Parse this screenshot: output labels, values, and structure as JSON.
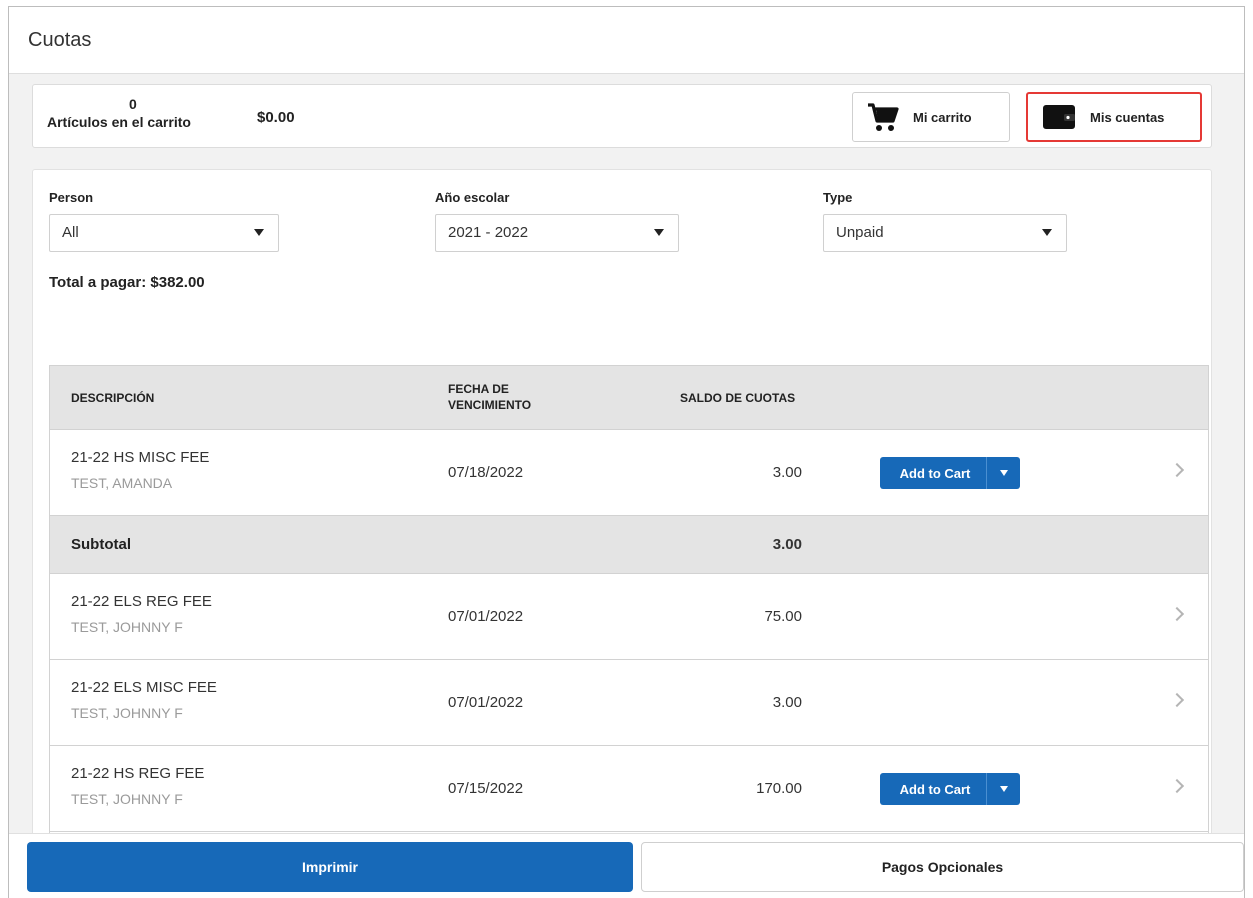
{
  "page": {
    "title": "Cuotas"
  },
  "cart": {
    "count": "0",
    "count_label": "Artículos en el carrito",
    "total": "$0.00",
    "my_cart_label": "Mi carrito",
    "my_accounts_label": "Mis cuentas",
    "cart_icon": "shopping-cart-icon",
    "accounts_icon": "wallet-icon"
  },
  "filters": {
    "person": {
      "label": "Person",
      "value": "All"
    },
    "school_year": {
      "label": "Año escolar",
      "value": "2021 - 2022"
    },
    "type": {
      "label": "Type",
      "value": "Unpaid"
    }
  },
  "total_due": "Total a pagar: $382.00",
  "table": {
    "headers": {
      "description": "DESCRIPCIÓN",
      "due_date_line1": "FECHA DE",
      "due_date_line2": "VENCIMIENTO",
      "balance": "SALDO DE CUOTAS"
    },
    "rows": [
      {
        "description": "21-22 HS MISC FEE",
        "person": "TEST, AMANDA",
        "due": "07/18/2022",
        "amount": "3.00",
        "add_to_cart": "Add to Cart"
      },
      {
        "subtotal_label": "Subtotal",
        "amount": "3.00"
      },
      {
        "description": "21-22 ELS REG FEE",
        "person": "TEST, JOHNNY F",
        "due": "07/01/2022",
        "amount": "75.00"
      },
      {
        "description": "21-22 ELS MISC FEE",
        "person": "TEST, JOHNNY F",
        "due": "07/01/2022",
        "amount": "3.00"
      },
      {
        "description": "21-22 HS REG FEE",
        "person": "TEST, JOHNNY F",
        "due": "07/15/2022",
        "amount": "170.00",
        "add_to_cart": "Add to Cart"
      }
    ]
  },
  "footer": {
    "print_label": "Imprimir",
    "optional_label": "Pagos Opcionales"
  },
  "colors": {
    "primary": "#1769b8",
    "highlight": "#e53935",
    "header_bg": "#e4e4e4"
  }
}
